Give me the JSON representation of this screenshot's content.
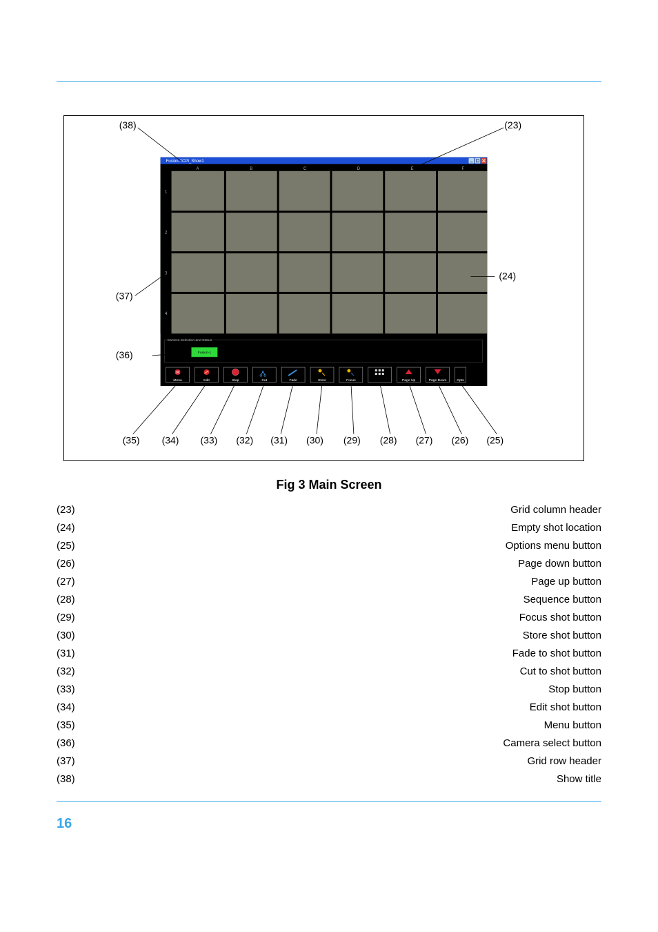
{
  "page_number": "16",
  "caption": "Fig 3  Main Screen",
  "callouts_top": {
    "c38": "(38)",
    "c23": "(23)",
    "c37": "(37)",
    "c24": "(24)",
    "c36": "(36)"
  },
  "callouts_bottom": [
    "(35)",
    "(34)",
    "(33)",
    "(32)",
    "(31)",
    "(30)",
    "(29)",
    "(28)",
    "(27)",
    "(26)",
    "(25)"
  ],
  "app": {
    "title": "Fusion-TCPI_Show1",
    "camera_panel": "Camera Selection and Status",
    "camera_button": "Fusion-1",
    "columns": [
      "A",
      "B",
      "C",
      "D",
      "E",
      "F"
    ],
    "rows": [
      "1",
      "2",
      "3",
      "4"
    ],
    "toolbar": [
      "Menu",
      "Edit",
      "Stop",
      "Cut",
      "Fade",
      "Store",
      "Focus",
      " ",
      "Page Up",
      "Page Down",
      "Opts"
    ]
  },
  "legend": [
    {
      "k": "(23)",
      "v": "Grid column header"
    },
    {
      "k": "(24)",
      "v": "Empty shot location"
    },
    {
      "k": "(25)",
      "v": "Options menu button"
    },
    {
      "k": "(26)",
      "v": "Page down button"
    },
    {
      "k": "(27)",
      "v": "Page up button"
    },
    {
      "k": "(28)",
      "v": "Sequence button"
    },
    {
      "k": "(29)",
      "v": "Focus shot button"
    },
    {
      "k": "(30)",
      "v": "Store shot button"
    },
    {
      "k": "(31)",
      "v": "Fade to shot button"
    },
    {
      "k": "(32)",
      "v": "Cut to shot button"
    },
    {
      "k": "(33)",
      "v": "Stop button"
    },
    {
      "k": "(34)",
      "v": "Edit shot button"
    },
    {
      "k": "(35)",
      "v": "Menu button"
    },
    {
      "k": "(36)",
      "v": "Camera select button"
    },
    {
      "k": "(37)",
      "v": "Grid row header"
    },
    {
      "k": "(38)",
      "v": "Show title"
    }
  ]
}
